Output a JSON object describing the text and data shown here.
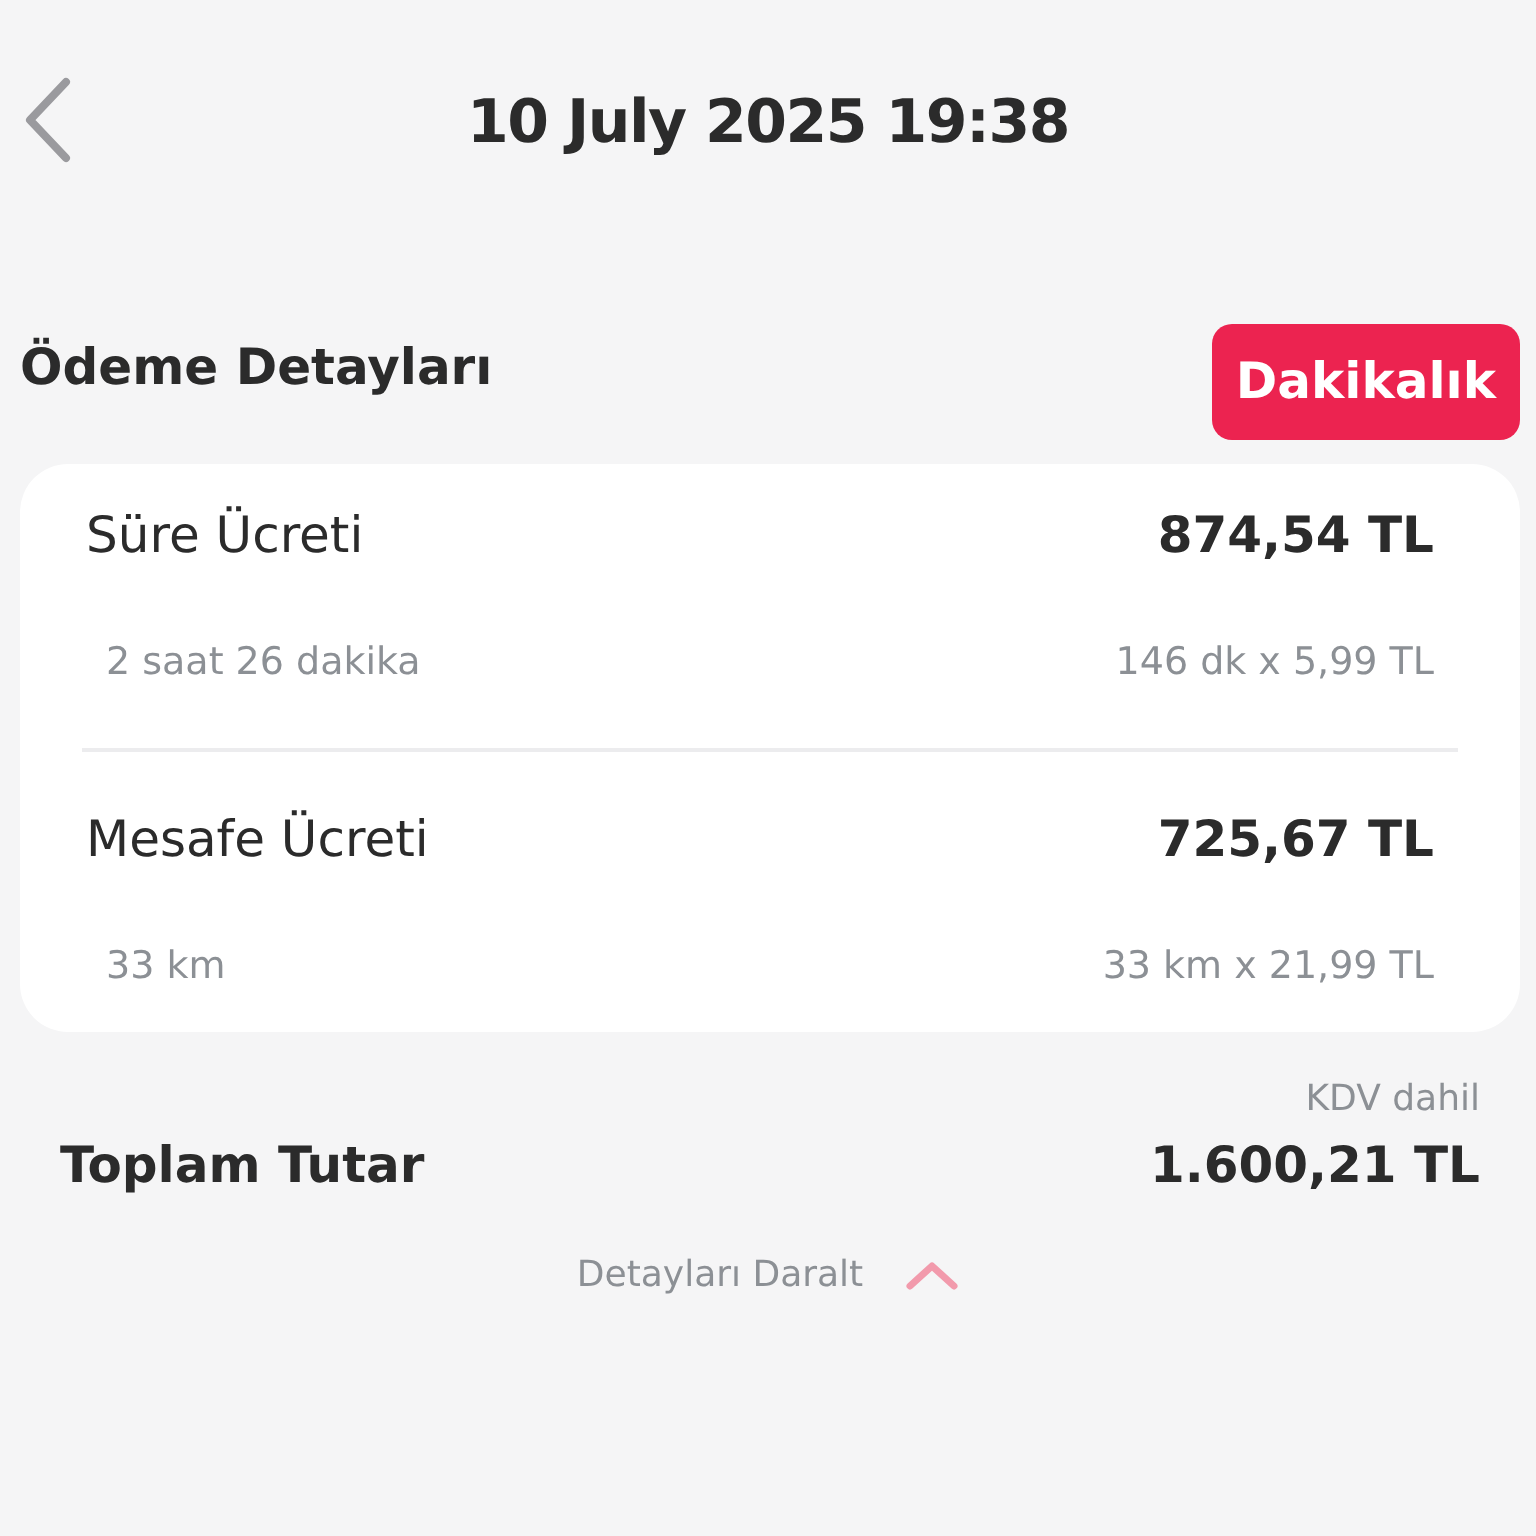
{
  "header": {
    "title": "10 July 2025 19:38"
  },
  "section": {
    "title": "Ödeme Detayları",
    "badge": "Dakikalık"
  },
  "fees": [
    {
      "label": "Süre Ücreti",
      "amount": "874,54 TL",
      "detail": "2 saat 26 dakika",
      "calculation": "146 dk x 5,99 TL"
    },
    {
      "label": "Mesafe Ücreti",
      "amount": "725,67 TL",
      "detail": "33 km",
      "calculation": "33 km x 21,99 TL"
    }
  ],
  "total": {
    "note": "KDV dahil",
    "label": "Toplam Tutar",
    "amount": "1.600,21 TL"
  },
  "toggle": {
    "label": "Detayları Daralt",
    "expanded": true
  }
}
